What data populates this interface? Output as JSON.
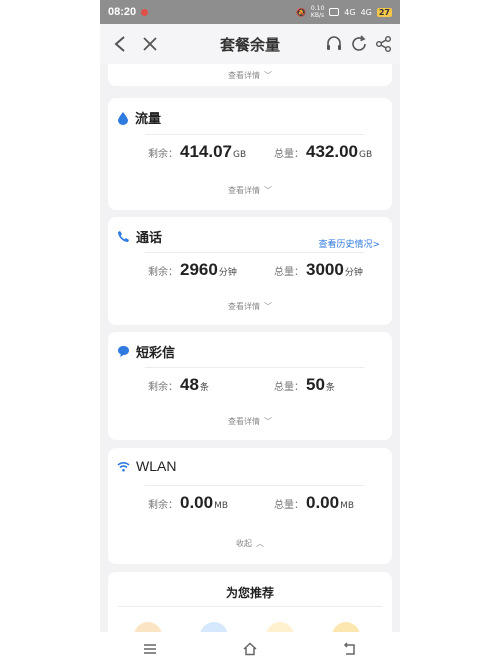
{
  "statusbar": {
    "time": "08:20",
    "network_speed": "0.10\nKB/s",
    "signal1": "4G",
    "signal2": "4G",
    "battery": "27"
  },
  "header": {
    "title": "套餐余量"
  },
  "top_card": {
    "detail": "查看详情"
  },
  "cards": [
    {
      "title": "流量",
      "remain_label": "剩余：",
      "remain_value": "414.07",
      "remain_unit": "GB",
      "total_label": "总量：",
      "total_value": "432.00",
      "total_unit": "GB",
      "detail": "查看详情",
      "icon": "drop-icon"
    },
    {
      "title": "通话",
      "link": "查看历史情况>",
      "remain_label": "剩余：",
      "remain_value": "2960",
      "remain_unit": "分钟",
      "total_label": "总量：",
      "total_value": "3000",
      "total_unit": "分钟",
      "detail": "查看详情",
      "icon": "phone-icon"
    },
    {
      "title": "短彩信",
      "remain_label": "剩余：",
      "remain_value": "48",
      "remain_unit": "条",
      "total_label": "总量：",
      "total_value": "50",
      "total_unit": "条",
      "detail": "查看详情",
      "icon": "message-icon"
    },
    {
      "title": "WLAN",
      "remain_label": "剩余：",
      "remain_value": "0.00",
      "remain_unit": "MB",
      "total_label": "总量：",
      "total_value": "0.00",
      "total_unit": "MB",
      "detail": "收起",
      "icon": "wifi-icon"
    }
  ],
  "recommend": {
    "title": "为您推荐"
  },
  "colors": {
    "accent": "#2f7be0",
    "background": "#f2f2f4",
    "statusbar": "#8e8e8e"
  }
}
